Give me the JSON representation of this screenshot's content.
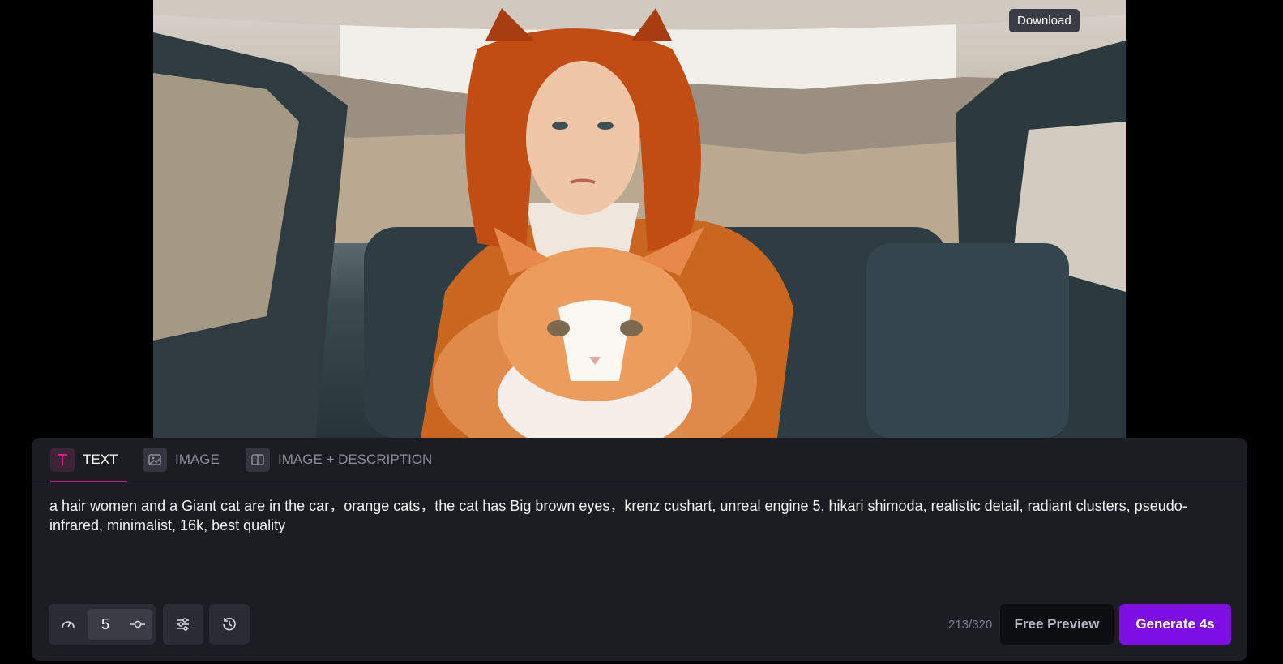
{
  "preview": {
    "download_tooltip": "Download",
    "image_subject": "woman with orange hair holding a large orange and white cat in a car"
  },
  "tabs": [
    {
      "label": "TEXT",
      "icon": "text-icon",
      "active": true
    },
    {
      "label": "IMAGE",
      "icon": "image-icon",
      "active": false
    },
    {
      "label": "IMAGE + DESCRIPTION",
      "icon": "split-image-icon",
      "active": false
    }
  ],
  "prompt": {
    "text": "a hair women and a Giant cat are in the car，orange cats，the cat has Big brown eyes，krenz cushart, unreal engine 5, hikari shimoda, realistic detail, radiant clusters, pseudo-infrared, minimalist, 16k, best quality"
  },
  "controls": {
    "steps_value": "5",
    "icons": [
      "speed-icon",
      "slider-icon",
      "settings-sliders-icon",
      "history-icon"
    ]
  },
  "footer": {
    "char_count": "213/320",
    "free_preview_label": "Free Preview",
    "generate_label": "Generate 4s"
  },
  "colors": {
    "accent_purple": "#7c0fe3",
    "tab_underline": "#d21f8c",
    "panel_bg": "#1c1d22"
  }
}
